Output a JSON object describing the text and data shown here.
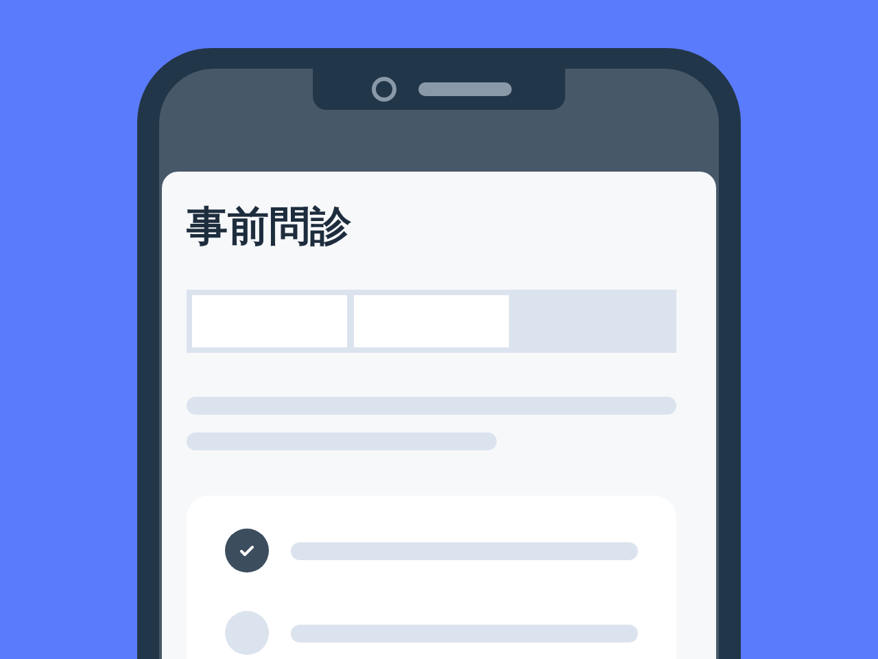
{
  "screen": {
    "title": "事前問診",
    "progress_steps": [
      {
        "done": true
      },
      {
        "done": true
      },
      {
        "done": false
      }
    ],
    "checklist": [
      {
        "checked": true
      },
      {
        "checked": false
      }
    ]
  }
}
